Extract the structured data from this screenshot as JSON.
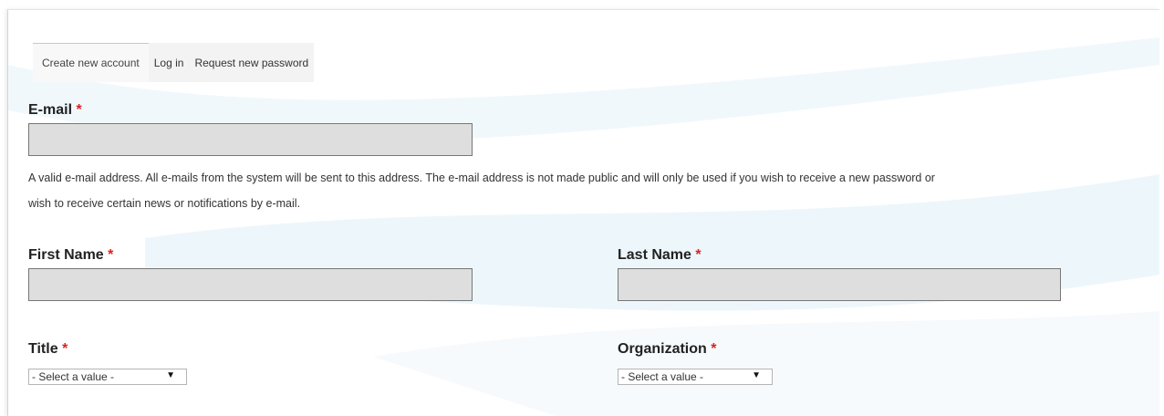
{
  "tabs": {
    "create": "Create new account",
    "login": "Log in",
    "request": "Request new password"
  },
  "required_mark": "*",
  "email": {
    "label": "E-mail",
    "value": "",
    "help": "A valid e-mail address. All e-mails from the system will be sent to this address. The e-mail address is not made public and will only be used if you wish to receive a new password or wish to receive certain news or notifications by e-mail."
  },
  "first_name": {
    "label": "First Name",
    "value": ""
  },
  "last_name": {
    "label": "Last Name",
    "value": ""
  },
  "title": {
    "label": "Title",
    "selected": "- Select a value -",
    "arrow": "▼"
  },
  "organization": {
    "label": "Organization",
    "selected": "- Select a value -",
    "arrow": "▼"
  }
}
